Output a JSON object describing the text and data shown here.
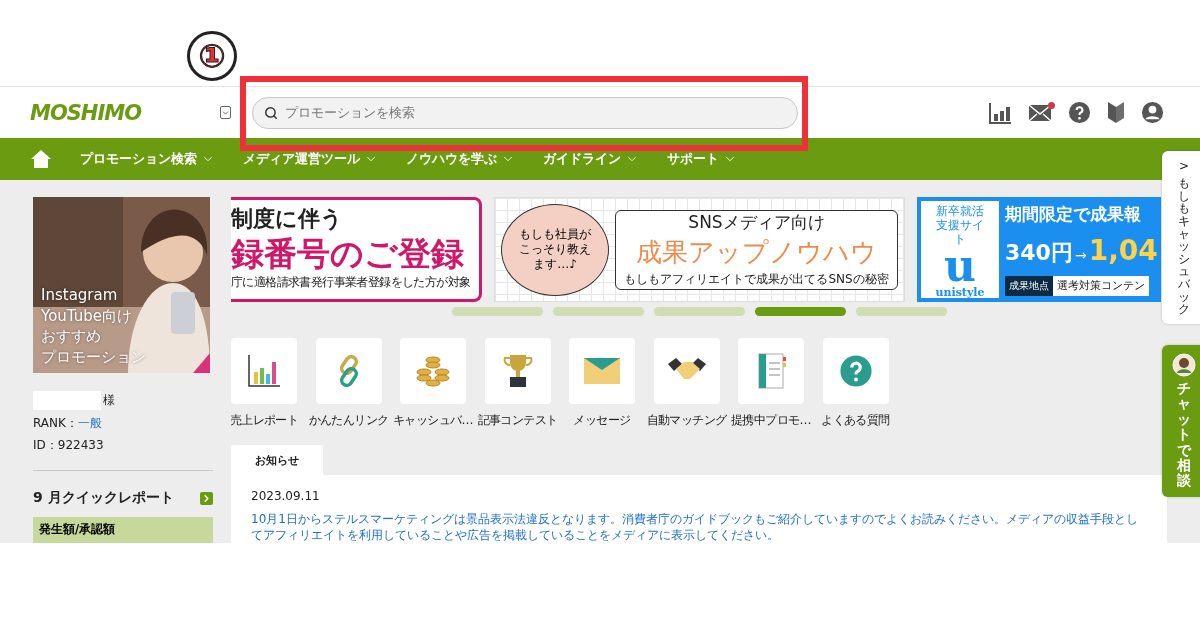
{
  "annotation": {
    "label": "①"
  },
  "header": {
    "logo": "MOSHIMO",
    "search": {
      "placeholder": "プロモーションを検索"
    },
    "icons": [
      {
        "kind": "chart",
        "badge": false
      },
      {
        "kind": "mail",
        "badge": true
      },
      {
        "kind": "help",
        "badge": false
      },
      {
        "kind": "beginner",
        "badge": false
      },
      {
        "kind": "user",
        "badge": false
      }
    ]
  },
  "nav": {
    "items": [
      {
        "label": "プロモーション検索"
      },
      {
        "label": "メディア運営ツール"
      },
      {
        "label": "ノウハウを学ぶ"
      },
      {
        "label": "ガイドライン"
      },
      {
        "label": "サポート"
      }
    ]
  },
  "promo_card": {
    "lines": [
      "Instagram",
      "YouTube向け",
      "おすすめ",
      "プロモーション"
    ]
  },
  "user": {
    "honorific": "様",
    "rank_label": "RANK：",
    "rank": "一般",
    "id": "ID：922433"
  },
  "quick_report": {
    "title": "9 月クイックレポート",
    "row": "発生額/承認額"
  },
  "banners": [
    {
      "kind": "notice",
      "title": "制度に伴う",
      "headline": "録番号のご登録",
      "note": "庁に適格請求書発行事業者登録をした方が対象"
    },
    {
      "kind": "notebook",
      "bubble": "もしも社員がこっそり教えます…♪",
      "title": "SNSメディア向け",
      "headline": "成果アップノウハウ",
      "note": "もしもアフィリエイトで成果が出てるSNSの秘密"
    },
    {
      "kind": "campaign",
      "badge": "新卒就活支援サイト",
      "logo": "u",
      "brand": "unistyle",
      "title": "期間限定で成果報",
      "price_from": "340円",
      "arrow": "→",
      "price_to": "1,04",
      "tag": "成果地点",
      "note": "選考対策コンテン"
    }
  ],
  "carousel_dots": [
    {
      "selected": false
    },
    {
      "selected": false
    },
    {
      "selected": false
    },
    {
      "selected": true
    },
    {
      "selected": false
    }
  ],
  "shortcuts": [
    {
      "kind": "chart",
      "label": "売上レポート"
    },
    {
      "kind": "link",
      "label": "かんたんリンク"
    },
    {
      "kind": "coins",
      "label": "キャッシュバ…"
    },
    {
      "kind": "trophy",
      "label": "記事コンテスト"
    },
    {
      "kind": "mail",
      "label": "メッセージ"
    },
    {
      "kind": "handshake",
      "label": "自動マッチング"
    },
    {
      "kind": "document",
      "label": "提携中プロモ…"
    },
    {
      "kind": "help",
      "label": "よくある質問"
    }
  ],
  "tabs": [
    {
      "label": "お知らせ",
      "selected": true
    }
  ],
  "news": [
    {
      "date": "2023.09.11",
      "text": "10月1日からステルスマーケティングは景品表示法違反となります。消費者庁のガイドブックもご紹介していますのでよくお読みください。メディアの収益手段としてアフィリエイトを利用していることや広告を掲載していることをメディアに表示してください。"
    }
  ],
  "side_tabs": [
    {
      "kind": "cashback",
      "arrow": ">",
      "label": "もしもキャッシュバック"
    },
    {
      "kind": "chat",
      "label": "チャットで相談"
    }
  ]
}
